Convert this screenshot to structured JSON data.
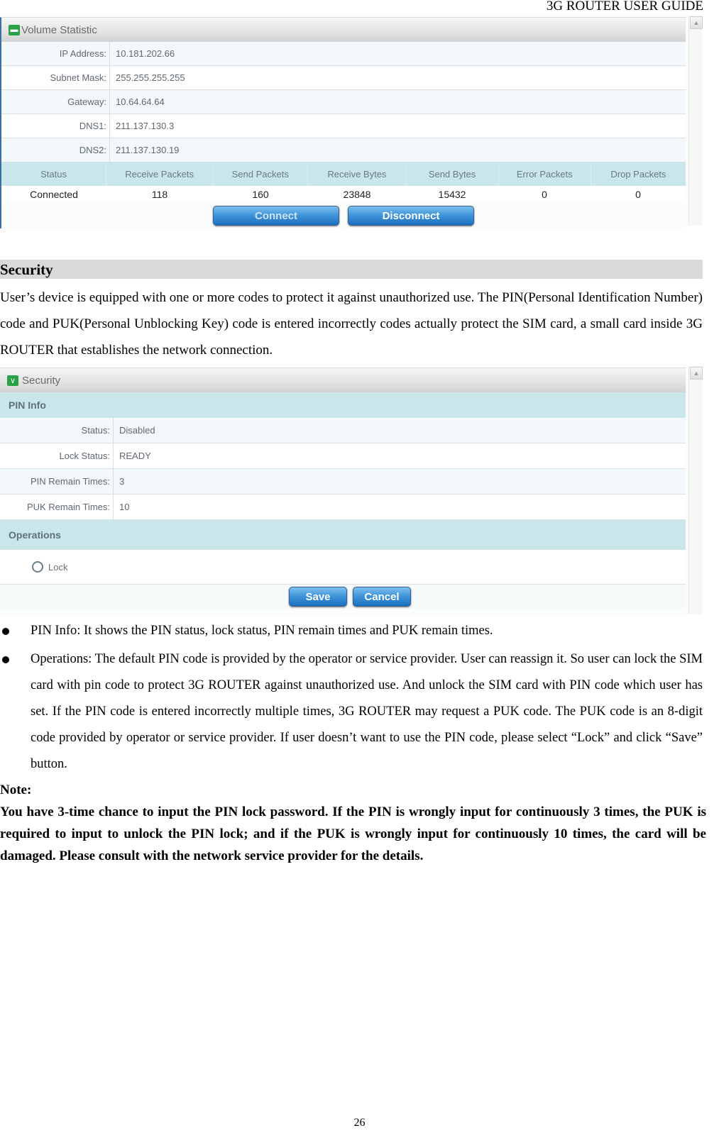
{
  "header": {
    "title": "3G ROUTER USER GUIDE"
  },
  "page_number": "26",
  "volume_panel": {
    "title": "Volume Statistic",
    "title_icon": "green-window-icon",
    "fields": [
      {
        "label": "IP Address:",
        "value": "10.181.202.66"
      },
      {
        "label": "Subnet Mask:",
        "value": "255.255.255.255"
      },
      {
        "label": "Gateway:",
        "value": "10.64.64.64"
      },
      {
        "label": "DNS1:",
        "value": "211.137.130.3"
      },
      {
        "label": "DNS2:",
        "value": "211.137.130.19"
      }
    ],
    "stats_columns": [
      "Status",
      "Receive Packets",
      "Send Packets",
      "Receive Bytes",
      "Send Bytes",
      "Error Packets",
      "Drop Packets"
    ],
    "stats_row": [
      "Connected",
      "118",
      "160",
      "23848",
      "15432",
      "0",
      "0"
    ],
    "buttons": {
      "connect": "Connect",
      "disconnect": "Disconnect"
    }
  },
  "section": {
    "title": "Security",
    "intro": "User’s device is equipped with one or more codes to protect it against unauthorized use. The PIN(Personal Identification Number) code and PUK(Personal Unblocking Key) code is entered incorrectly codes actually protect the SIM card, a small card inside 3G ROUTER that establishes the network connection."
  },
  "security_panel": {
    "title": "Security",
    "title_icon": "green-chevron-icon",
    "pin_info_header": "PIN Info",
    "fields": [
      {
        "label": "Status:",
        "value": "Disabled"
      },
      {
        "label": "Lock Status:",
        "value": "READY"
      },
      {
        "label": "PIN Remain Times:",
        "value": "3"
      },
      {
        "label": "PUK Remain Times:",
        "value": "10"
      }
    ],
    "operations_header": "Operations",
    "lock_option": {
      "label": "Lock",
      "checked": false
    },
    "buttons": {
      "save": "Save",
      "cancel": "Cancel"
    }
  },
  "bullets": [
    "PIN Info: It shows the PIN status, lock status, PIN remain times and PUK remain times.",
    "Operations: The default PIN code is provided by the operator or service provider. User can reassign it. So user can lock the SIM card with pin code to protect 3G ROUTER against unauthorized use. And unlock the SIM card with PIN code which user has set. If the PIN code is entered incorrectly multiple times, 3G ROUTER may request a PUK code. The PUK code is an 8-digit code provided by operator or service provider. If user doesn’t want to use the PIN code, please select “Lock” and click “Save” button."
  ],
  "note": {
    "label": "Note:",
    "text": "You have 3-time chance to input the PIN lock password. If the PIN is wrongly input for continuously 3 times, the PUK is required to input to unlock the PIN lock; and if the PUK is wrongly input for continuously 10 times, the card will be damaged. Please consult with the network service provider for the details."
  }
}
